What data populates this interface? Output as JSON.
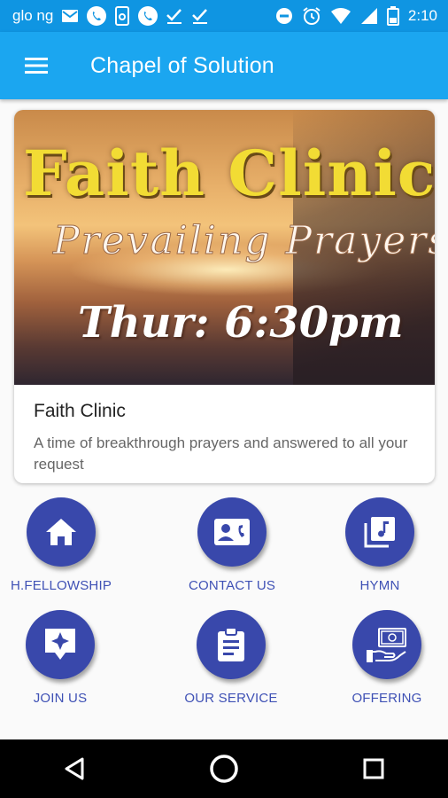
{
  "status_bar": {
    "carrier": "glo ng",
    "time": "2:10",
    "left_icons": [
      "mail-icon",
      "phone-icon",
      "sim-doc-icon",
      "phone-icon",
      "check-icon",
      "check-icon"
    ],
    "right_icons": [
      "do-not-disturb-icon",
      "alarm-icon",
      "wifi-icon",
      "signal-icon",
      "battery-icon"
    ]
  },
  "app_bar": {
    "title": "Chapel of Solution",
    "menu_icon": "hamburger-menu-icon",
    "color": "#1ba6f0"
  },
  "featured_card": {
    "banner": {
      "line1": "Faith Clinic",
      "line2": "Prevailing Prayers",
      "line3": "Thur: 6:30pm"
    },
    "title": "Faith Clinic",
    "description": "A time of breakthrough prayers and answered to all your request"
  },
  "menu_grid": {
    "accent_color": "#3948ab",
    "label_color": "#3f51b5",
    "items": [
      {
        "label": "H.FELLOWSHIP",
        "icon": "home-icon"
      },
      {
        "label": "CONTACT US",
        "icon": "contact-card-icon"
      },
      {
        "label": "HYMN",
        "icon": "music-library-icon"
      },
      {
        "label": "JOIN US",
        "icon": "sparkle-badge-icon"
      },
      {
        "label": "OUR SERVICE",
        "icon": "clipboard-icon"
      },
      {
        "label": "OFFERING",
        "icon": "cash-hand-icon"
      }
    ]
  },
  "nav_bar": {
    "buttons": [
      "back-icon",
      "home-circle-icon",
      "recents-icon"
    ]
  }
}
